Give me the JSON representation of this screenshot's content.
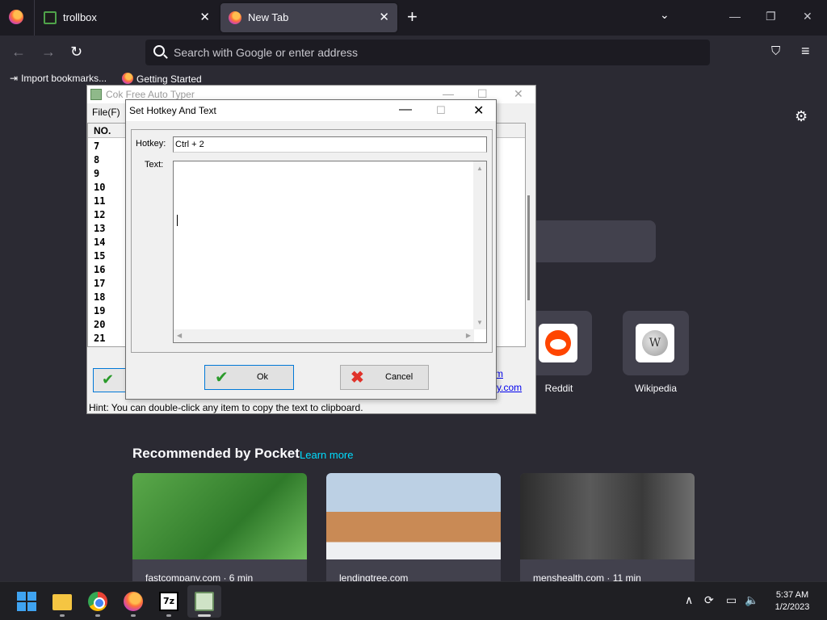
{
  "browser": {
    "tabs": [
      {
        "title": "trollbox",
        "active": false
      },
      {
        "title": "New Tab",
        "active": true
      }
    ],
    "address_placeholder": "Search with Google or enter address",
    "bookmarks": [
      "Import bookmarks...",
      "Getting Started"
    ]
  },
  "newtab": {
    "shortcuts": [
      {
        "label": "Reddit",
        "icon": "reddit-icon"
      },
      {
        "label": "Wikipedia",
        "icon": "wikipedia-icon"
      }
    ],
    "pocket_heading": "Recommended by Pocket",
    "pocket_learn_more": "Learn more",
    "pocket_cards": [
      {
        "source": "fastcompany.com · 6 min"
      },
      {
        "source": "lendingtree.com"
      },
      {
        "source": "menshealth.com · 11 min"
      }
    ]
  },
  "autotyper": {
    "title": "Cok Free Auto Typer",
    "menu_file": "File(F)",
    "list_header": "NO.",
    "rows": [
      "7",
      "8",
      "9",
      "10",
      "11",
      "12",
      "13",
      "14",
      "15",
      "16",
      "17",
      "18",
      "19",
      "20",
      "21"
    ],
    "link1": "m",
    "link2": "y.com",
    "hint": "Hint: You can double-click any item to copy the text to clipboard."
  },
  "dialog": {
    "title": "Set Hotkey And Text",
    "hotkey_label": "Hotkey:",
    "hotkey_value": "Ctrl + 2",
    "text_label": "Text:",
    "text_value": "",
    "ok_label": "Ok",
    "cancel_label": "Cancel"
  },
  "taskbar": {
    "time": "5:37 AM",
    "date": "1/2/2023",
    "apps": [
      "windows-start",
      "file-explorer",
      "chrome",
      "firefox",
      "7-zip",
      "auto-typer"
    ]
  },
  "colors": {
    "firefox_bg": "#2b2a33",
    "pocket_link": "#00ddff",
    "dialog_accent": "#0078d7"
  }
}
